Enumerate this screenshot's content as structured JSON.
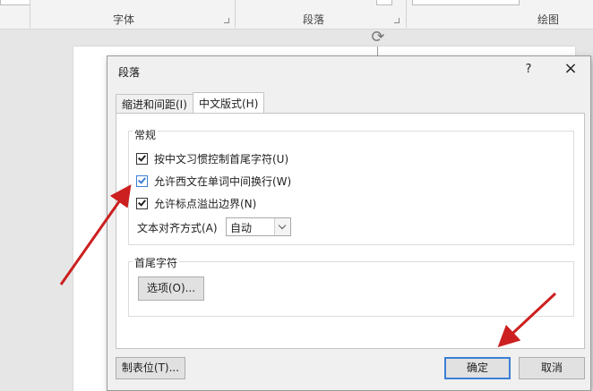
{
  "ribbon": {
    "groups": [
      {
        "label": "字体"
      },
      {
        "label": "段落"
      },
      {
        "label": "绘图"
      }
    ]
  },
  "dialog": {
    "title": "段落",
    "help_label": "?",
    "close_label": "×",
    "tabs": [
      {
        "label": "缩进和间距(I)",
        "active": false
      },
      {
        "label": "中文版式(H)",
        "active": true
      }
    ],
    "general": {
      "title": "常规",
      "options": [
        {
          "label": "按中文习惯控制首尾字符(U)",
          "checked": true
        },
        {
          "label": "允许西文在单词中间换行(W)",
          "checked": true
        },
        {
          "label": "允许标点溢出边界(N)",
          "checked": true
        }
      ],
      "align_label": "文本对齐方式(A)",
      "align_value": "自动"
    },
    "headtail": {
      "title": "首尾字符",
      "options_button": "选项(O)..."
    },
    "buttons": {
      "tabs_button": "制表位(T)...",
      "ok": "确定",
      "cancel": "取消"
    }
  },
  "annotations": {
    "arrow_color": "#cc1f1f"
  }
}
